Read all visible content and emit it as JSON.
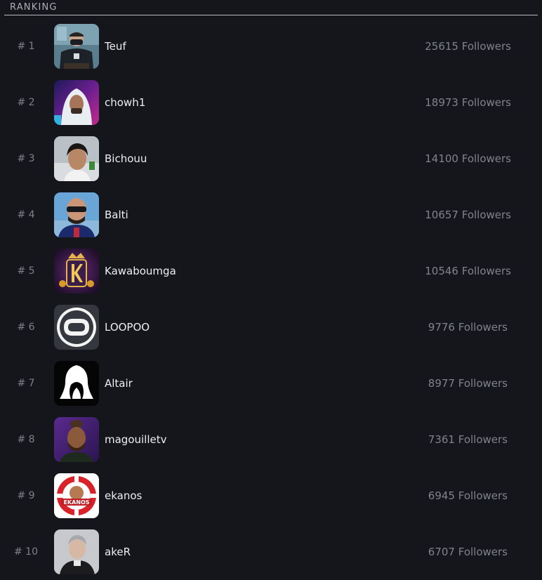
{
  "header": {
    "title": "RANKING"
  },
  "ranking": [
    {
      "rank": "# 1",
      "name": "Teuf",
      "followers": "25615 Followers",
      "avatar": "avatar-teuf"
    },
    {
      "rank": "# 2",
      "name": "chowh1",
      "followers": "18973 Followers",
      "avatar": "avatar-chowh1"
    },
    {
      "rank": "# 3",
      "name": "Bichouu",
      "followers": "14100 Followers",
      "avatar": "avatar-bichouu"
    },
    {
      "rank": "# 4",
      "name": "Balti",
      "followers": "10657 Followers",
      "avatar": "avatar-balti"
    },
    {
      "rank": "# 5",
      "name": "Kawaboumga",
      "followers": "10546 Followers",
      "avatar": "avatar-kawaboumga"
    },
    {
      "rank": "# 6",
      "name": "LOOPOO",
      "followers": "9776 Followers",
      "avatar": "avatar-loopoo"
    },
    {
      "rank": "# 7",
      "name": "Altair",
      "followers": "8977 Followers",
      "avatar": "avatar-altair"
    },
    {
      "rank": "# 8",
      "name": "magouilletv",
      "followers": "7361 Followers",
      "avatar": "avatar-magouilletv"
    },
    {
      "rank": "# 9",
      "name": "ekanos",
      "followers": "6945 Followers",
      "avatar": "avatar-ekanos",
      "logo_text": "EKANOS"
    },
    {
      "rank": "# 10",
      "name": "akeR",
      "followers": "6707 Followers",
      "avatar": "avatar-aker"
    }
  ]
}
